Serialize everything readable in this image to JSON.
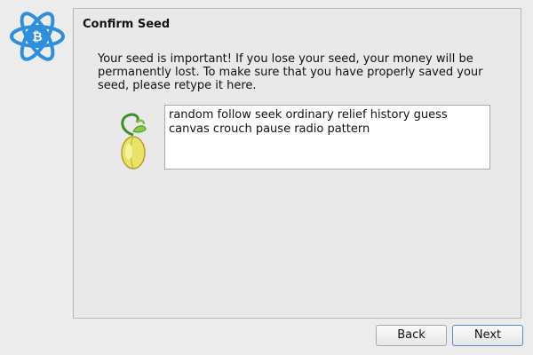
{
  "app_logo": {
    "icon": "electrum-bitcoin-logo-icon",
    "color": "#2f8fdd"
  },
  "dialog": {
    "title": "Confirm Seed",
    "message": "Your seed is important! If you lose your seed, your money will be permanently lost. To make sure that you have properly saved your seed, please retype it here.",
    "seed_icon": "seed-sprout-icon",
    "seed_input_value": "random follow seek ordinary relief history guess canvas crouch pause radio pattern"
  },
  "buttons": {
    "back_label": "Back",
    "next_label": "Next"
  }
}
